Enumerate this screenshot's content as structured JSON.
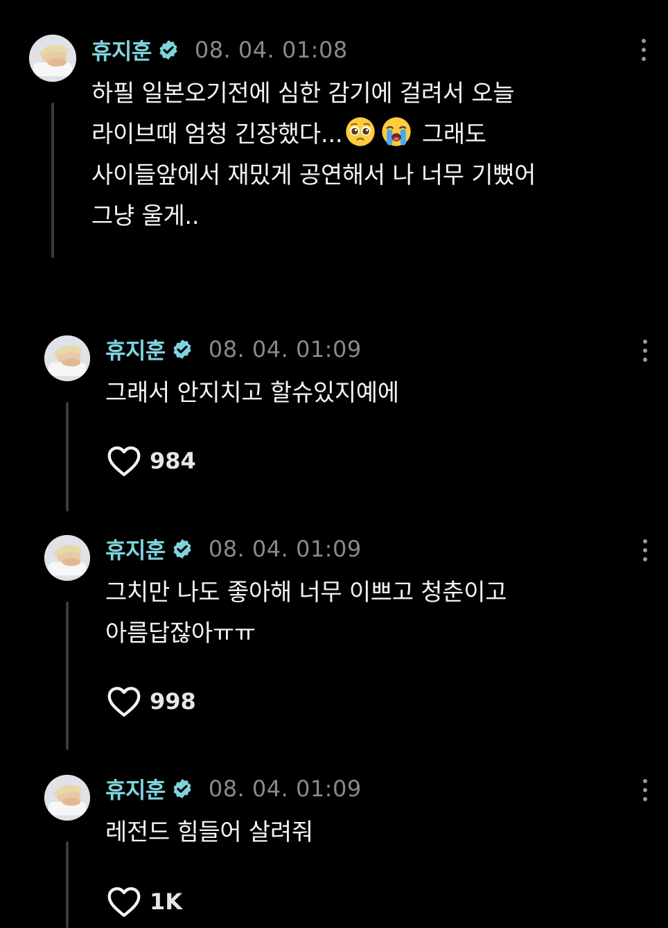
{
  "posts": [
    {
      "username": "휴지훈",
      "timestamp": "08. 04. 01:08",
      "lines": [
        "하필 일본오기전에 심한 감기에 걸려서 오늘",
        "라이브때 엄청 긴장했다...",
        "사이들앞에서 재밌게 공연해서 나 너무 기뻤어",
        "그냥 울게.."
      ],
      "line2_after_emoji": "그래도",
      "emojis": [
        "pleading-face",
        "loudly-crying-face"
      ]
    },
    {
      "username": "휴지훈",
      "timestamp": "08. 04. 01:09",
      "lines": [
        "그래서 안지치고 할슈있지예에"
      ],
      "likes": "984"
    },
    {
      "username": "휴지훈",
      "timestamp": "08. 04. 01:09",
      "lines": [
        "그치만 나도 좋아해 너무 이쁘고 청춘이고",
        "아름답잖아ㅠㅠ"
      ],
      "likes": "998"
    },
    {
      "username": "휴지훈",
      "timestamp": "08. 04. 01:09",
      "lines": [
        "레전드 힘들어 살려줘"
      ],
      "likes": "1K"
    }
  ],
  "icons": {
    "verified": "verified-badge-icon",
    "more": "more-options-icon",
    "like": "heart-icon"
  },
  "colors": {
    "background": "#000000",
    "username": "#7fd3de",
    "verified_badge": "#7fd3de",
    "timestamp": "#8a8a8a",
    "text": "#f4f4f4",
    "thread_line": "#3a3a3a"
  }
}
